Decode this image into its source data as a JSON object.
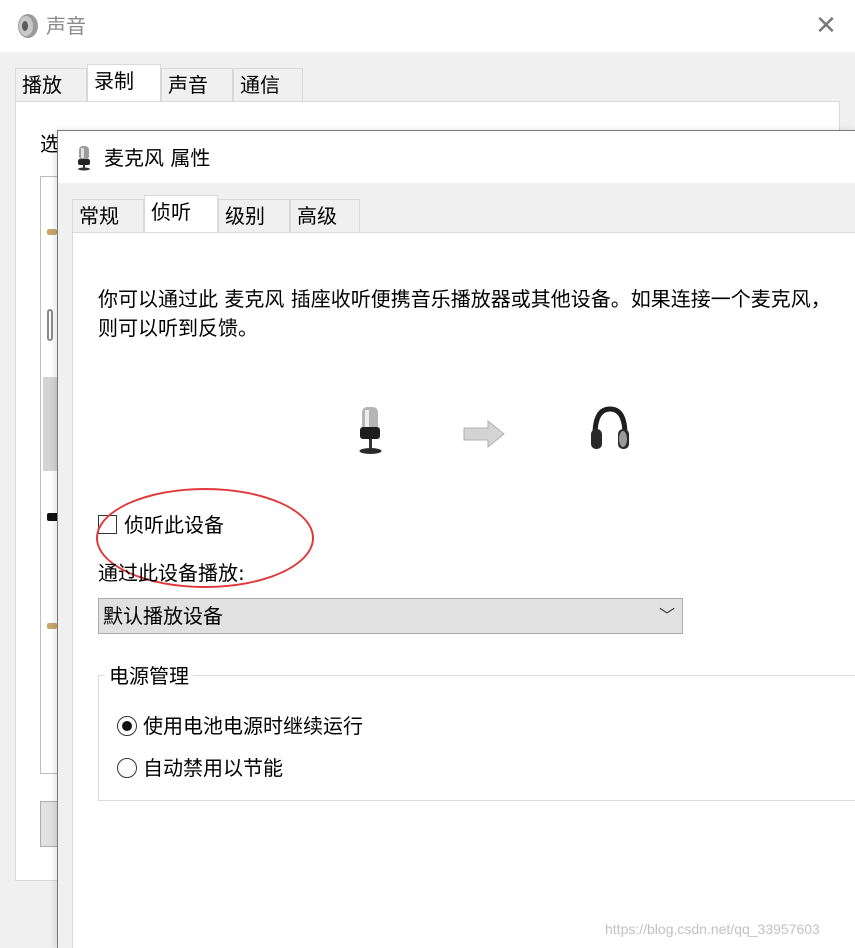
{
  "back_window": {
    "title": "声音",
    "close_glyph": "✕",
    "tabs": [
      {
        "label": "播放",
        "active": false
      },
      {
        "label": "录制",
        "active": true
      },
      {
        "label": "声音",
        "active": false
      },
      {
        "label": "通信",
        "active": false
      }
    ],
    "partial_label": "选"
  },
  "front_window": {
    "title": "麦克风 属性",
    "tabs": [
      {
        "label": "常规",
        "active": false
      },
      {
        "label": "侦听",
        "active": true
      },
      {
        "label": "级别",
        "active": false
      },
      {
        "label": "高级",
        "active": false
      }
    ],
    "description": "你可以通过此 麦克风 插座收听便携音乐播放器或其他设备。如果连接一个麦克风，则可以听到反馈。",
    "illustration": {
      "source_icon": "microphone-icon",
      "arrow_icon": "arrow-right-icon",
      "target_icon": "headphones-icon"
    },
    "listen_checkbox": {
      "label": "侦听此设备",
      "checked": false
    },
    "playback_label": "通过此设备播放:",
    "playback_select": {
      "value": "默认播放设备",
      "chevron": "﹀"
    },
    "power_group": {
      "title": "电源管理",
      "options": [
        {
          "label": "使用电池电源时继续运行",
          "selected": true
        },
        {
          "label": "自动禁用以节能",
          "selected": false
        }
      ]
    }
  },
  "annotation": {
    "color": "#e0393b"
  },
  "watermark": "https://blog.csdn.net/qq_33957603"
}
